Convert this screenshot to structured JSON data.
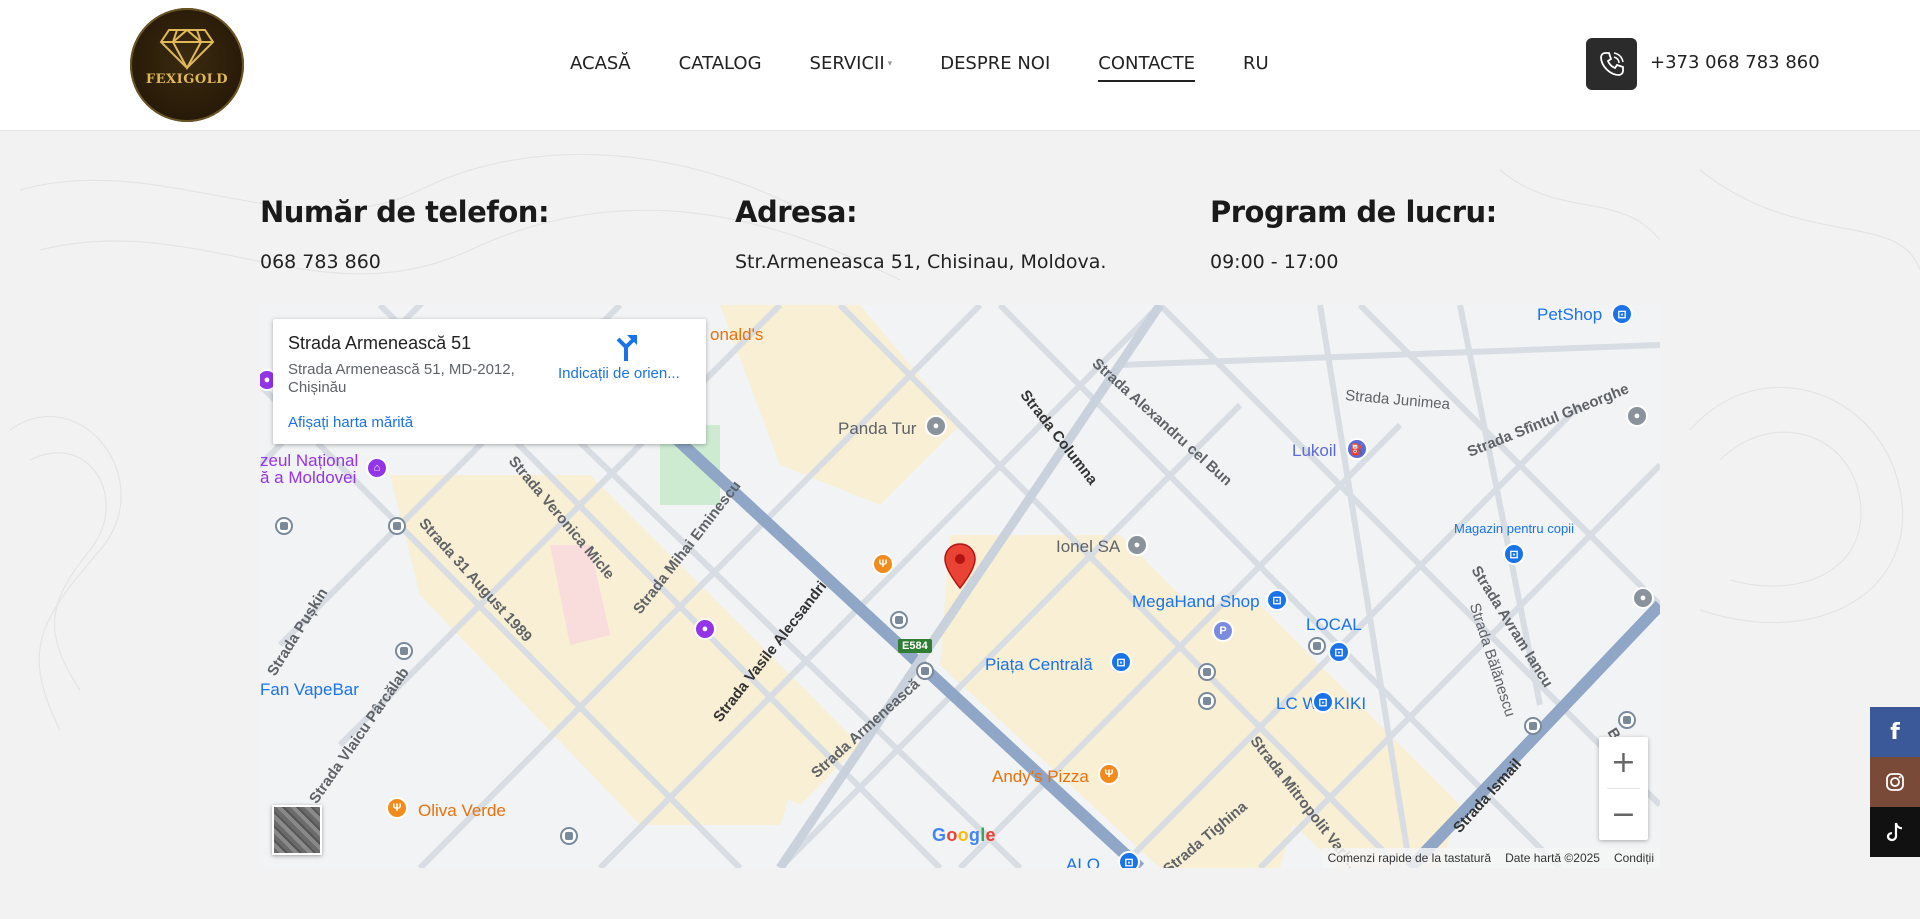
{
  "header": {
    "logo_text": "FEXIGOLD",
    "nav": [
      {
        "label": "ACASĂ"
      },
      {
        "label": "CATALOG"
      },
      {
        "label": "SERVICII"
      },
      {
        "label": "DESPRE NOI"
      },
      {
        "label": "CONTACTE",
        "active": true
      },
      {
        "label": "RU"
      }
    ],
    "phone": "+373 068 783 860"
  },
  "contact": {
    "phone_title": "Număr de telefon:",
    "phone_value": "068 783 860",
    "address_title": "Adresa:",
    "address_value": "Str.Armeneasca 51, Chisinau, Moldova.",
    "hours_title": "Program de lucru:",
    "hours_value": "09:00 - 17:00"
  },
  "map": {
    "card": {
      "title": "Strada Armenească 51",
      "address": "Strada Armenească 51, MD-2012, Chișinău",
      "link": "Afișați harta mărită",
      "directions": "Indicații de orien..."
    },
    "streets": [
      "Strada Alexandru cel Bun",
      "Strada Columna",
      "Strada Junimea",
      "Strada Sfîntul Gheorghe",
      "Strada Veronica Micle",
      "Strada 31 August 1989",
      "Strada Mihai Eminescu",
      "Strada Vasile Alecsandri",
      "Strada Armenească",
      "Strada Pușkin",
      "Strada Vlaicu Pârcălab",
      "Strada Avram Iancu",
      "Strada Bălănescu",
      "Strada Mitropolit Varl...",
      "Strada Tighina",
      "Strada Ismail",
      "E584"
    ],
    "pois": [
      "PetShop",
      "Lukoil",
      "Panda Tur",
      "Ionel SA",
      "MegaHand Shop",
      "LOCAL",
      "Magazin pentru copii",
      "Piața Centrală",
      "LC WAIKIKI",
      "Andy's Pizza",
      "Oliva Verde",
      "Fan VapeBar",
      "ALO",
      "onald's",
      "zeul Național",
      "ă a Moldovei",
      "P",
      "Brâncu..."
    ],
    "zoom_in": "+",
    "zoom_out": "−",
    "google": "Google",
    "attribution": [
      "Comenzi rapide de la tastatură",
      "Date hartă ©2025",
      "Condiții"
    ]
  },
  "social": [
    {
      "name": "facebook",
      "icon": "f",
      "color": "#3b5998"
    },
    {
      "name": "instagram",
      "color": "#7a4a38"
    },
    {
      "name": "tiktok",
      "color": "#111111"
    }
  ],
  "colors": {
    "accent_dark": "#2b2b2b",
    "link_blue": "#1a73e8",
    "map_bg": "#f1f3f4",
    "map_block": "#f8efd5",
    "marker_red": "#ea4335"
  }
}
